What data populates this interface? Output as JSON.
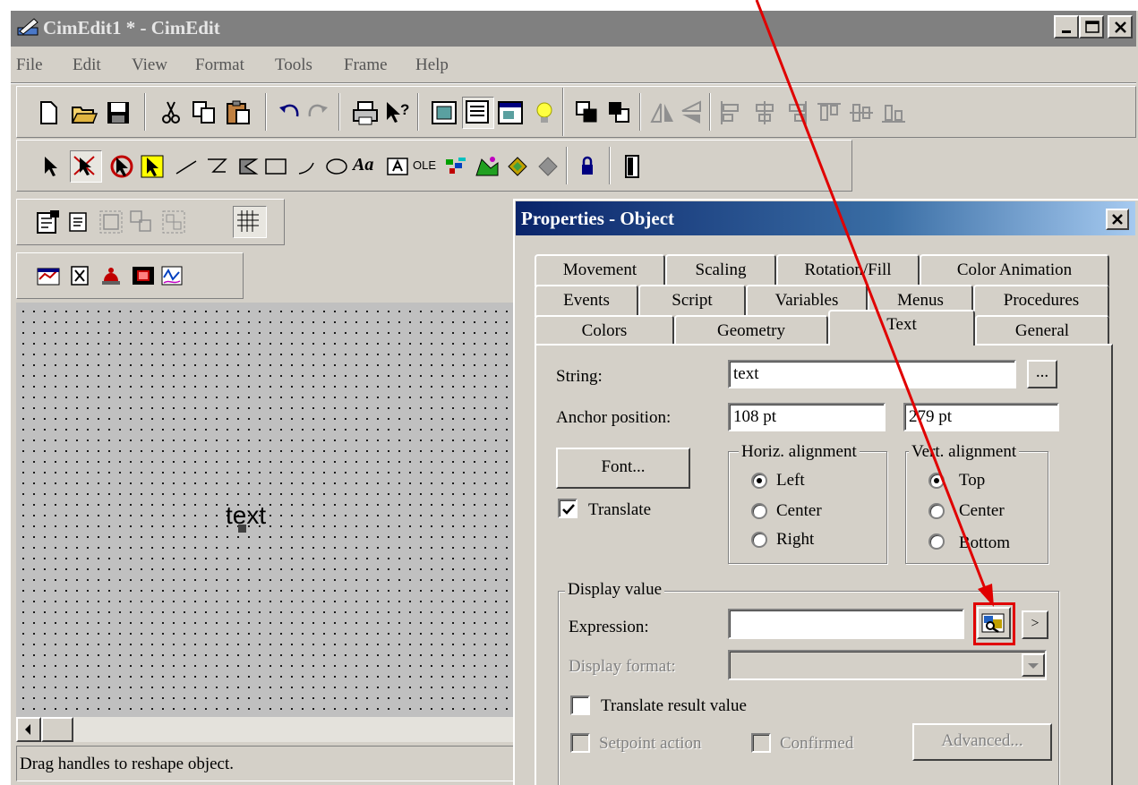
{
  "window": {
    "title": "CimEdit1 * - CimEdit"
  },
  "menu": [
    {
      "label": "File"
    },
    {
      "label": "Edit"
    },
    {
      "label": "View"
    },
    {
      "label": "Format"
    },
    {
      "label": "Tools"
    },
    {
      "label": "Frame"
    },
    {
      "label": "Help"
    }
  ],
  "toolbar": {
    "ole_label": "OLE",
    "text_tool_label": "Aa"
  },
  "canvas": {
    "object_text": "text"
  },
  "statusbar": {
    "text": "Drag handles to reshape object."
  },
  "dialog": {
    "title": "Properties - Object",
    "tabs": {
      "row1": [
        "Movement",
        "Scaling",
        "Rotation/Fill",
        "Color Animation"
      ],
      "row2": [
        "Events",
        "Script",
        "Variables",
        "Menus",
        "Procedures"
      ],
      "row3": [
        "Colors",
        "Geometry",
        "Text",
        "General"
      ],
      "active": "Text"
    },
    "text_tab": {
      "string_label": "String:",
      "string_value": "text",
      "browse_label": "...",
      "anchor_label": "Anchor position:",
      "anchor_x": "108 pt",
      "anchor_y": "279 pt",
      "font_button": "Font...",
      "translate_label": "Translate",
      "translate_checked": true,
      "horiz_group": "Horiz. alignment",
      "horiz_options": [
        "Left",
        "Center",
        "Right"
      ],
      "horiz_selected": "Left",
      "vert_group": "Vert. alignment",
      "vert_options": [
        "Top",
        "Center",
        "Bottom"
      ],
      "vert_selected": "Top",
      "display_group": "Display value",
      "expression_label": "Expression:",
      "expression_value": "",
      "expr_more_label": ">",
      "display_format_label": "Display format:",
      "translate_result_label": "Translate result value",
      "setpoint_label": "Setpoint action",
      "confirmed_label": "Confirmed",
      "advanced_button": "Advanced..."
    }
  },
  "colors": {
    "annotation": "#e00000",
    "dialog_title": "#0a246a",
    "face": "#d4d0c8"
  }
}
